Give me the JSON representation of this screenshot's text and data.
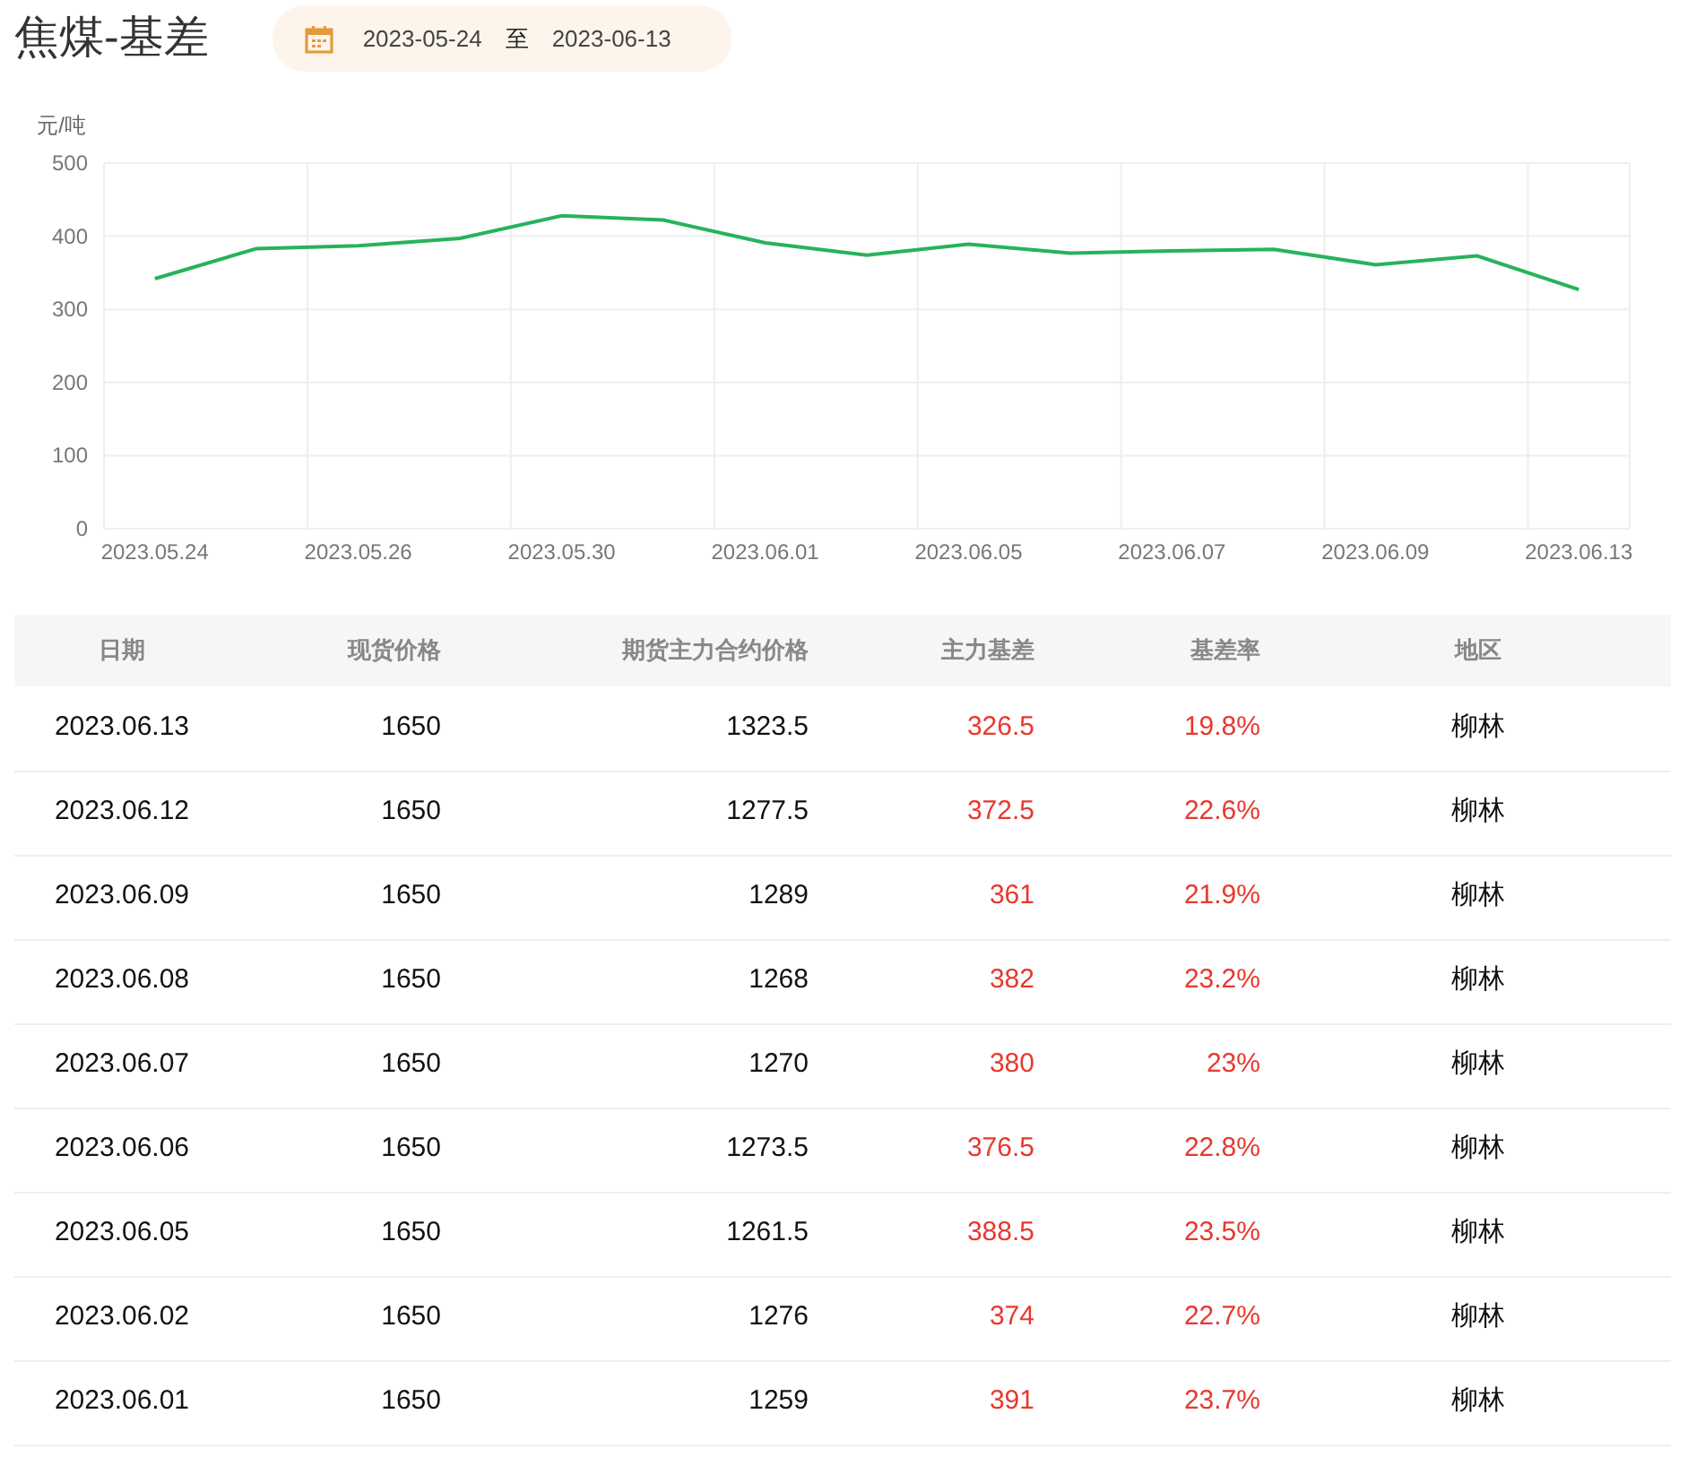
{
  "title": "焦煤-基差",
  "date_range": {
    "start": "2023-05-24",
    "separator": "至",
    "end": "2023-06-13"
  },
  "chart": {
    "chart_data": {
      "type": "line",
      "ylabel": "元/吨",
      "categories": [
        "2023.05.24",
        null,
        "2023.05.26",
        null,
        "2023.05.30",
        null,
        "2023.06.01",
        null,
        "2023.06.05",
        null,
        "2023.06.07",
        null,
        "2023.06.09",
        null,
        "2023.06.13"
      ],
      "grid": true,
      "ylim": [
        0,
        500
      ],
      "yticks": [
        0,
        100,
        200,
        300,
        400,
        500
      ],
      "series": [
        {
          "color": "#27b35a",
          "values": [
            342,
            383,
            387,
            397,
            428,
            422,
            391,
            374,
            389,
            377,
            380,
            382,
            361,
            373,
            327
          ]
        }
      ]
    }
  },
  "table": {
    "columns": [
      "日期",
      "现货价格",
      "期货主力合约价格",
      "主力基差",
      "基差率",
      "地区"
    ],
    "rows": [
      [
        "2023.06.13",
        "1650",
        "1323.5",
        "326.5",
        "19.8%",
        "柳林"
      ],
      [
        "2023.06.12",
        "1650",
        "1277.5",
        "372.5",
        "22.6%",
        "柳林"
      ],
      [
        "2023.06.09",
        "1650",
        "1289",
        "361",
        "21.9%",
        "柳林"
      ],
      [
        "2023.06.08",
        "1650",
        "1268",
        "382",
        "23.2%",
        "柳林"
      ],
      [
        "2023.06.07",
        "1650",
        "1270",
        "380",
        "23%",
        "柳林"
      ],
      [
        "2023.06.06",
        "1650",
        "1273.5",
        "376.5",
        "22.8%",
        "柳林"
      ],
      [
        "2023.06.05",
        "1650",
        "1261.5",
        "388.5",
        "23.5%",
        "柳林"
      ],
      [
        "2023.06.02",
        "1650",
        "1276",
        "374",
        "22.7%",
        "柳林"
      ],
      [
        "2023.06.01",
        "1650",
        "1259",
        "391",
        "23.7%",
        "柳林"
      ]
    ]
  }
}
